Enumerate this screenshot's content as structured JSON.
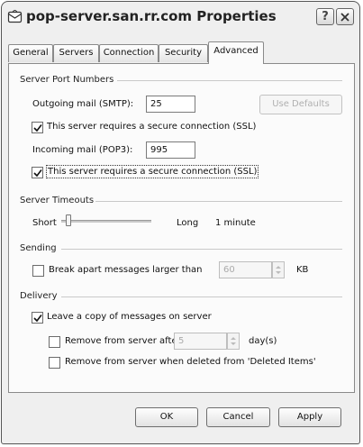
{
  "window": {
    "title": "pop-server.san.rr.com Properties",
    "help_label": "?",
    "close_label": "X"
  },
  "tabs": [
    {
      "label": "General"
    },
    {
      "label": "Servers"
    },
    {
      "label": "Connection"
    },
    {
      "label": "Security"
    },
    {
      "label": "Advanced"
    }
  ],
  "port_numbers": {
    "group_label": "Server Port Numbers",
    "outgoing_label": "Outgoing mail (SMTP):",
    "outgoing_value": "25",
    "use_defaults_label": "Use Defaults",
    "smtp_ssl_label": "This server requires a secure connection (SSL)",
    "smtp_ssl_checked": true,
    "incoming_label": "Incoming mail (POP3):",
    "incoming_value": "995",
    "pop_ssl_label": "This server requires a secure connection (SSL)",
    "pop_ssl_checked": true
  },
  "timeouts": {
    "group_label": "Server Timeouts",
    "short_label": "Short",
    "long_label": "Long",
    "value_label": "1 minute",
    "slider_fraction": 0.05
  },
  "sending": {
    "group_label": "Sending",
    "break_label": "Break apart messages larger than",
    "break_checked": false,
    "size_value": "60",
    "unit_label": "KB"
  },
  "delivery": {
    "group_label": "Delivery",
    "leave_copy_label": "Leave a copy of messages on server",
    "leave_copy_checked": true,
    "remove_after_label": "Remove from server after",
    "remove_after_checked": false,
    "days_value": "5",
    "days_unit_label": "day(s)",
    "remove_deleted_label": "Remove from server when deleted from 'Deleted Items'",
    "remove_deleted_checked": false
  },
  "footer": {
    "ok_label": "OK",
    "cancel_label": "Cancel",
    "apply_label": "Apply"
  },
  "colors": {
    "window_bg": "#efefef",
    "panel_bg": "#fbfbfb",
    "disabled_text": "#9a9a9a"
  }
}
